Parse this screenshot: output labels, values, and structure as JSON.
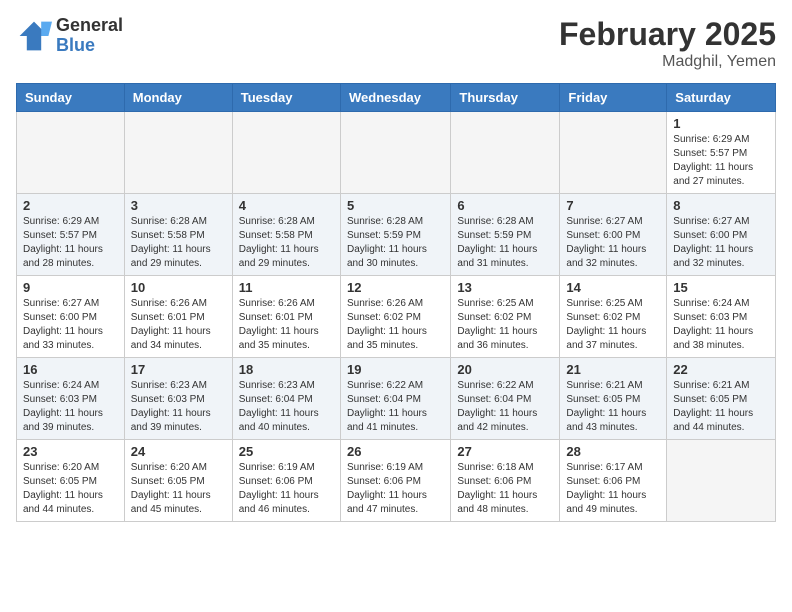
{
  "header": {
    "logo_general": "General",
    "logo_blue": "Blue",
    "month_title": "February 2025",
    "location": "Madghil, Yemen"
  },
  "days_of_week": [
    "Sunday",
    "Monday",
    "Tuesday",
    "Wednesday",
    "Thursday",
    "Friday",
    "Saturday"
  ],
  "weeks": [
    {
      "row_class": "row-light",
      "days": [
        {
          "num": "",
          "info": "",
          "empty": true
        },
        {
          "num": "",
          "info": "",
          "empty": true
        },
        {
          "num": "",
          "info": "",
          "empty": true
        },
        {
          "num": "",
          "info": "",
          "empty": true
        },
        {
          "num": "",
          "info": "",
          "empty": true
        },
        {
          "num": "",
          "info": "",
          "empty": true
        },
        {
          "num": "1",
          "info": "Sunrise: 6:29 AM\nSunset: 5:57 PM\nDaylight: 11 hours and 27 minutes.",
          "empty": false
        }
      ]
    },
    {
      "row_class": "row-dark",
      "days": [
        {
          "num": "2",
          "info": "Sunrise: 6:29 AM\nSunset: 5:57 PM\nDaylight: 11 hours and 28 minutes.",
          "empty": false
        },
        {
          "num": "3",
          "info": "Sunrise: 6:28 AM\nSunset: 5:58 PM\nDaylight: 11 hours and 29 minutes.",
          "empty": false
        },
        {
          "num": "4",
          "info": "Sunrise: 6:28 AM\nSunset: 5:58 PM\nDaylight: 11 hours and 29 minutes.",
          "empty": false
        },
        {
          "num": "5",
          "info": "Sunrise: 6:28 AM\nSunset: 5:59 PM\nDaylight: 11 hours and 30 minutes.",
          "empty": false
        },
        {
          "num": "6",
          "info": "Sunrise: 6:28 AM\nSunset: 5:59 PM\nDaylight: 11 hours and 31 minutes.",
          "empty": false
        },
        {
          "num": "7",
          "info": "Sunrise: 6:27 AM\nSunset: 6:00 PM\nDaylight: 11 hours and 32 minutes.",
          "empty": false
        },
        {
          "num": "8",
          "info": "Sunrise: 6:27 AM\nSunset: 6:00 PM\nDaylight: 11 hours and 32 minutes.",
          "empty": false
        }
      ]
    },
    {
      "row_class": "row-light",
      "days": [
        {
          "num": "9",
          "info": "Sunrise: 6:27 AM\nSunset: 6:00 PM\nDaylight: 11 hours and 33 minutes.",
          "empty": false
        },
        {
          "num": "10",
          "info": "Sunrise: 6:26 AM\nSunset: 6:01 PM\nDaylight: 11 hours and 34 minutes.",
          "empty": false
        },
        {
          "num": "11",
          "info": "Sunrise: 6:26 AM\nSunset: 6:01 PM\nDaylight: 11 hours and 35 minutes.",
          "empty": false
        },
        {
          "num": "12",
          "info": "Sunrise: 6:26 AM\nSunset: 6:02 PM\nDaylight: 11 hours and 35 minutes.",
          "empty": false
        },
        {
          "num": "13",
          "info": "Sunrise: 6:25 AM\nSunset: 6:02 PM\nDaylight: 11 hours and 36 minutes.",
          "empty": false
        },
        {
          "num": "14",
          "info": "Sunrise: 6:25 AM\nSunset: 6:02 PM\nDaylight: 11 hours and 37 minutes.",
          "empty": false
        },
        {
          "num": "15",
          "info": "Sunrise: 6:24 AM\nSunset: 6:03 PM\nDaylight: 11 hours and 38 minutes.",
          "empty": false
        }
      ]
    },
    {
      "row_class": "row-dark",
      "days": [
        {
          "num": "16",
          "info": "Sunrise: 6:24 AM\nSunset: 6:03 PM\nDaylight: 11 hours and 39 minutes.",
          "empty": false
        },
        {
          "num": "17",
          "info": "Sunrise: 6:23 AM\nSunset: 6:03 PM\nDaylight: 11 hours and 39 minutes.",
          "empty": false
        },
        {
          "num": "18",
          "info": "Sunrise: 6:23 AM\nSunset: 6:04 PM\nDaylight: 11 hours and 40 minutes.",
          "empty": false
        },
        {
          "num": "19",
          "info": "Sunrise: 6:22 AM\nSunset: 6:04 PM\nDaylight: 11 hours and 41 minutes.",
          "empty": false
        },
        {
          "num": "20",
          "info": "Sunrise: 6:22 AM\nSunset: 6:04 PM\nDaylight: 11 hours and 42 minutes.",
          "empty": false
        },
        {
          "num": "21",
          "info": "Sunrise: 6:21 AM\nSunset: 6:05 PM\nDaylight: 11 hours and 43 minutes.",
          "empty": false
        },
        {
          "num": "22",
          "info": "Sunrise: 6:21 AM\nSunset: 6:05 PM\nDaylight: 11 hours and 44 minutes.",
          "empty": false
        }
      ]
    },
    {
      "row_class": "row-light",
      "days": [
        {
          "num": "23",
          "info": "Sunrise: 6:20 AM\nSunset: 6:05 PM\nDaylight: 11 hours and 44 minutes.",
          "empty": false
        },
        {
          "num": "24",
          "info": "Sunrise: 6:20 AM\nSunset: 6:05 PM\nDaylight: 11 hours and 45 minutes.",
          "empty": false
        },
        {
          "num": "25",
          "info": "Sunrise: 6:19 AM\nSunset: 6:06 PM\nDaylight: 11 hours and 46 minutes.",
          "empty": false
        },
        {
          "num": "26",
          "info": "Sunrise: 6:19 AM\nSunset: 6:06 PM\nDaylight: 11 hours and 47 minutes.",
          "empty": false
        },
        {
          "num": "27",
          "info": "Sunrise: 6:18 AM\nSunset: 6:06 PM\nDaylight: 11 hours and 48 minutes.",
          "empty": false
        },
        {
          "num": "28",
          "info": "Sunrise: 6:17 AM\nSunset: 6:06 PM\nDaylight: 11 hours and 49 minutes.",
          "empty": false
        },
        {
          "num": "",
          "info": "",
          "empty": true
        }
      ]
    }
  ]
}
